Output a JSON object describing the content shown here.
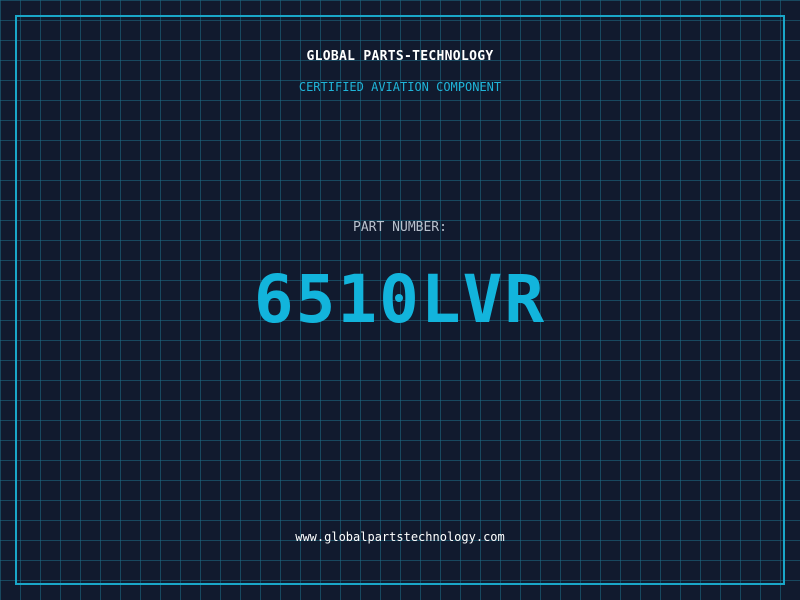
{
  "colors": {
    "background": "#111a2e",
    "grid": "#1e6e87",
    "frame": "#1aa6c8",
    "company": "#ffffff",
    "subtitle": "#1fb4d8",
    "label": "#b8c0cc",
    "part_number": "#12b4dc",
    "website": "#ffffff"
  },
  "header": {
    "company": "GLOBAL PARTS-TECHNOLOGY",
    "subtitle": "CERTIFIED AVIATION COMPONENT"
  },
  "part": {
    "label": "PART NUMBER:",
    "number": "6510LVR"
  },
  "footer": {
    "website": "www.globalpartstechnology.com"
  }
}
